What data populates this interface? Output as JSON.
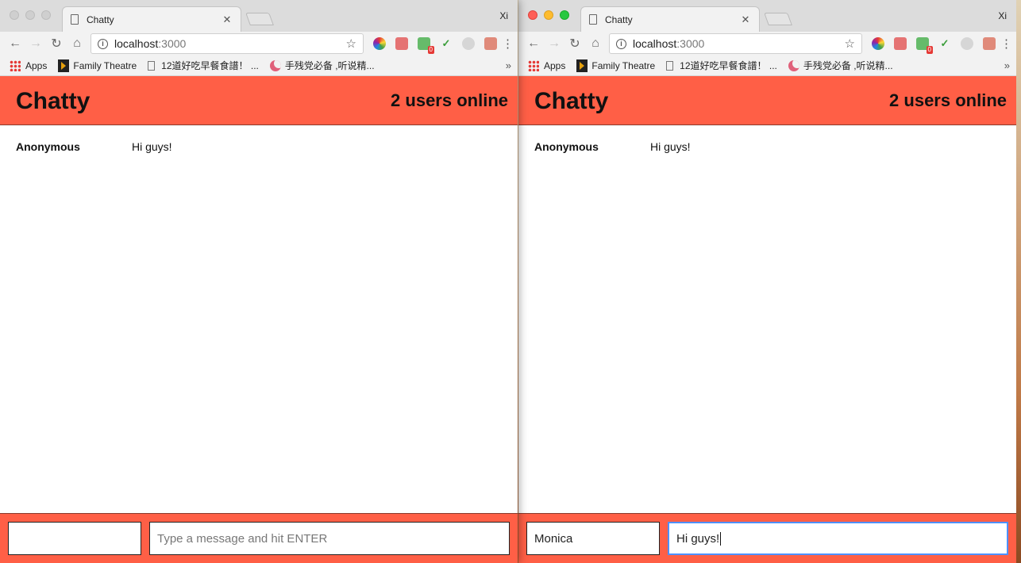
{
  "windows": [
    {
      "id": "left",
      "tab": {
        "title": "Chatty"
      },
      "profile": "Xi",
      "address": {
        "host": "localhost",
        "port": ":3000"
      },
      "extension_badge": "0",
      "bookmarks": {
        "items": [
          {
            "label": "Apps",
            "icon": "apps-grid-icon"
          },
          {
            "label": "Family Theatre",
            "icon": "plex-icon"
          },
          {
            "label": "12道好吃早餐食譜！ ...",
            "icon": "page-icon"
          },
          {
            "label": "手残党必备 ,听说精...",
            "icon": "moon-icon"
          }
        ],
        "more": "»"
      },
      "app": {
        "brand": "Chatty",
        "users_online": "2 users online",
        "messages": [
          {
            "username": "Anonymous",
            "content": "Hi guys!"
          }
        ],
        "chatbar": {
          "name_value": "",
          "message_value": "",
          "message_placeholder": "Type a message and hit ENTER"
        }
      }
    },
    {
      "id": "right",
      "tab": {
        "title": "Chatty"
      },
      "profile": "Xi",
      "address": {
        "host": "localhost",
        "port": ":3000"
      },
      "extension_badge": "0",
      "bookmarks": {
        "items": [
          {
            "label": "Apps",
            "icon": "apps-grid-icon"
          },
          {
            "label": "Family Theatre",
            "icon": "plex-icon"
          },
          {
            "label": "12道好吃早餐食譜！ ...",
            "icon": "page-icon"
          },
          {
            "label": "手残党必备 ,听说精...",
            "icon": "moon-icon"
          }
        ],
        "more": "»"
      },
      "app": {
        "brand": "Chatty",
        "users_online": "2 users online",
        "messages": [
          {
            "username": "Anonymous",
            "content": "Hi guys!"
          }
        ],
        "chatbar": {
          "name_value": "Monica",
          "message_value": "Hi guys!",
          "message_placeholder": ""
        }
      }
    }
  ],
  "colors": {
    "accent": "#ff5f46",
    "focus_ring": "#4d90fe"
  }
}
